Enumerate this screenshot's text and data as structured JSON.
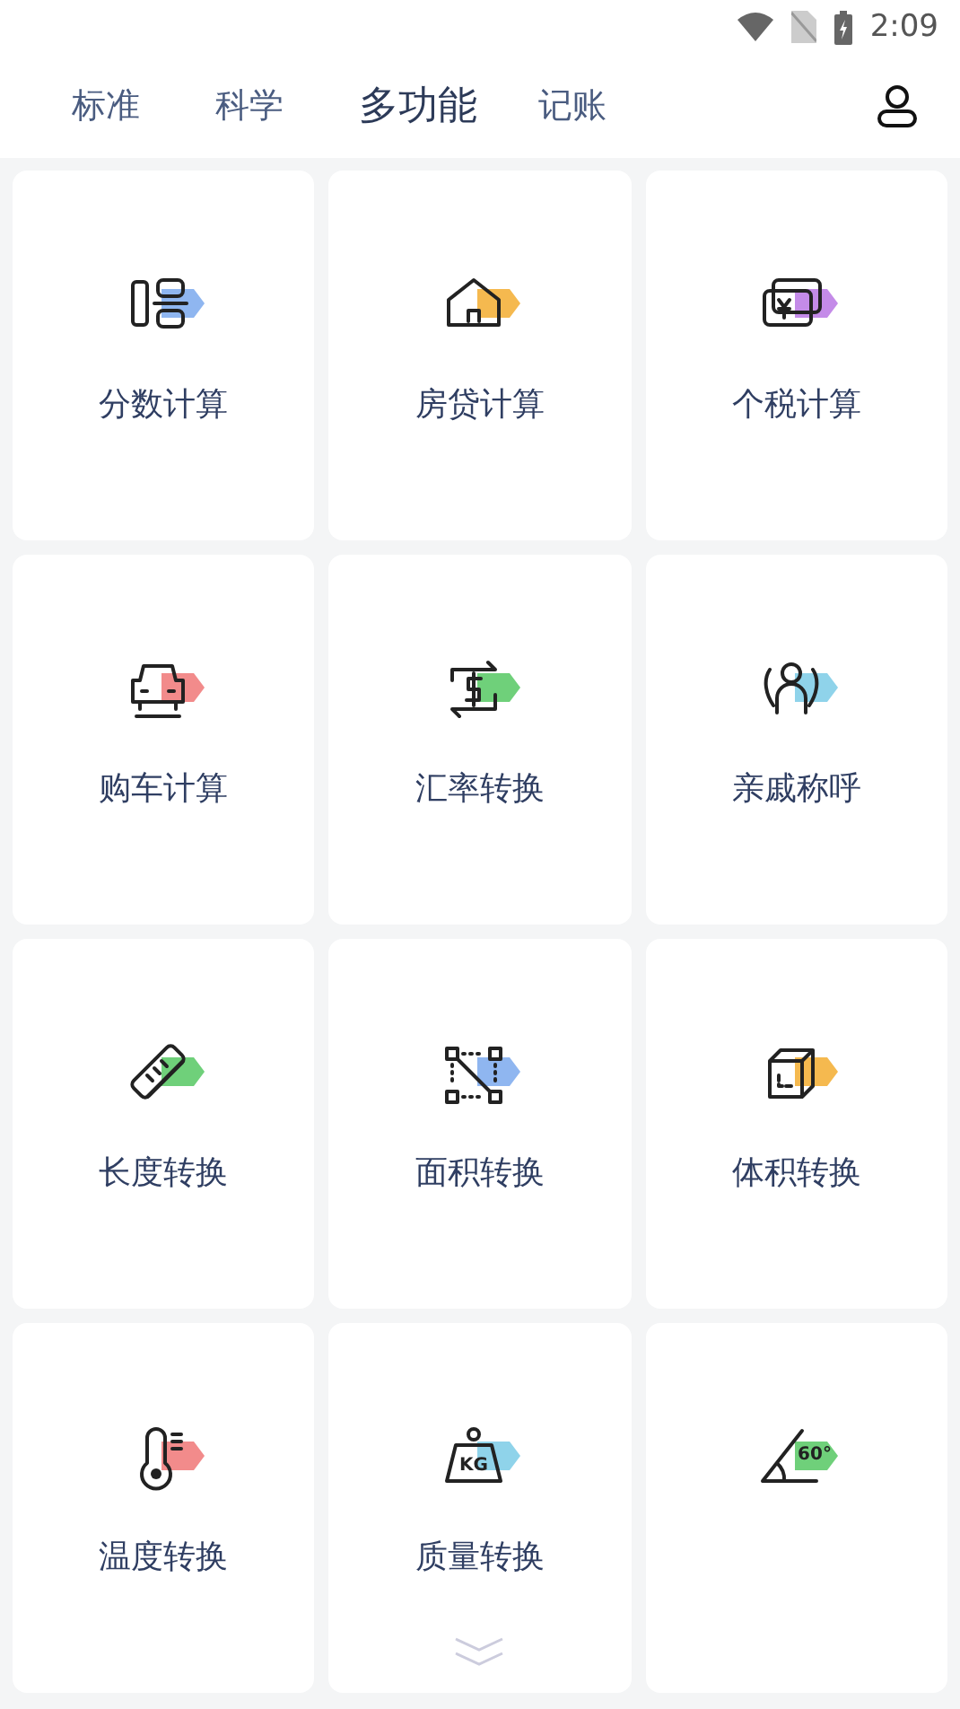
{
  "status_bar": {
    "time": "2:09"
  },
  "tabs": [
    {
      "label": "标准",
      "selected": false
    },
    {
      "label": "科学",
      "selected": false
    },
    {
      "label": "多功能",
      "selected": true
    },
    {
      "label": "记账",
      "selected": false
    }
  ],
  "tools": [
    {
      "label": "分数计算",
      "color": "#8fb6f0"
    },
    {
      "label": "房贷计算",
      "color": "#f5b94f"
    },
    {
      "label": "个税计算",
      "color": "#c48be8"
    },
    {
      "label": "购车计算",
      "color": "#f28b8b"
    },
    {
      "label": "汇率转换",
      "color": "#6fd07a"
    },
    {
      "label": "亲戚称呼",
      "color": "#8fd3ea"
    },
    {
      "label": "长度转换",
      "color": "#6fd07a"
    },
    {
      "label": "面积转换",
      "color": "#8fb6f0"
    },
    {
      "label": "体积转换",
      "color": "#f5b94f"
    },
    {
      "label": "温度转换",
      "color": "#f28b8b"
    },
    {
      "label": "质量转换",
      "color": "#8fd3ea",
      "icon_text": "KG"
    },
    {
      "color": "#6fd07a",
      "icon_text": "60°"
    }
  ]
}
